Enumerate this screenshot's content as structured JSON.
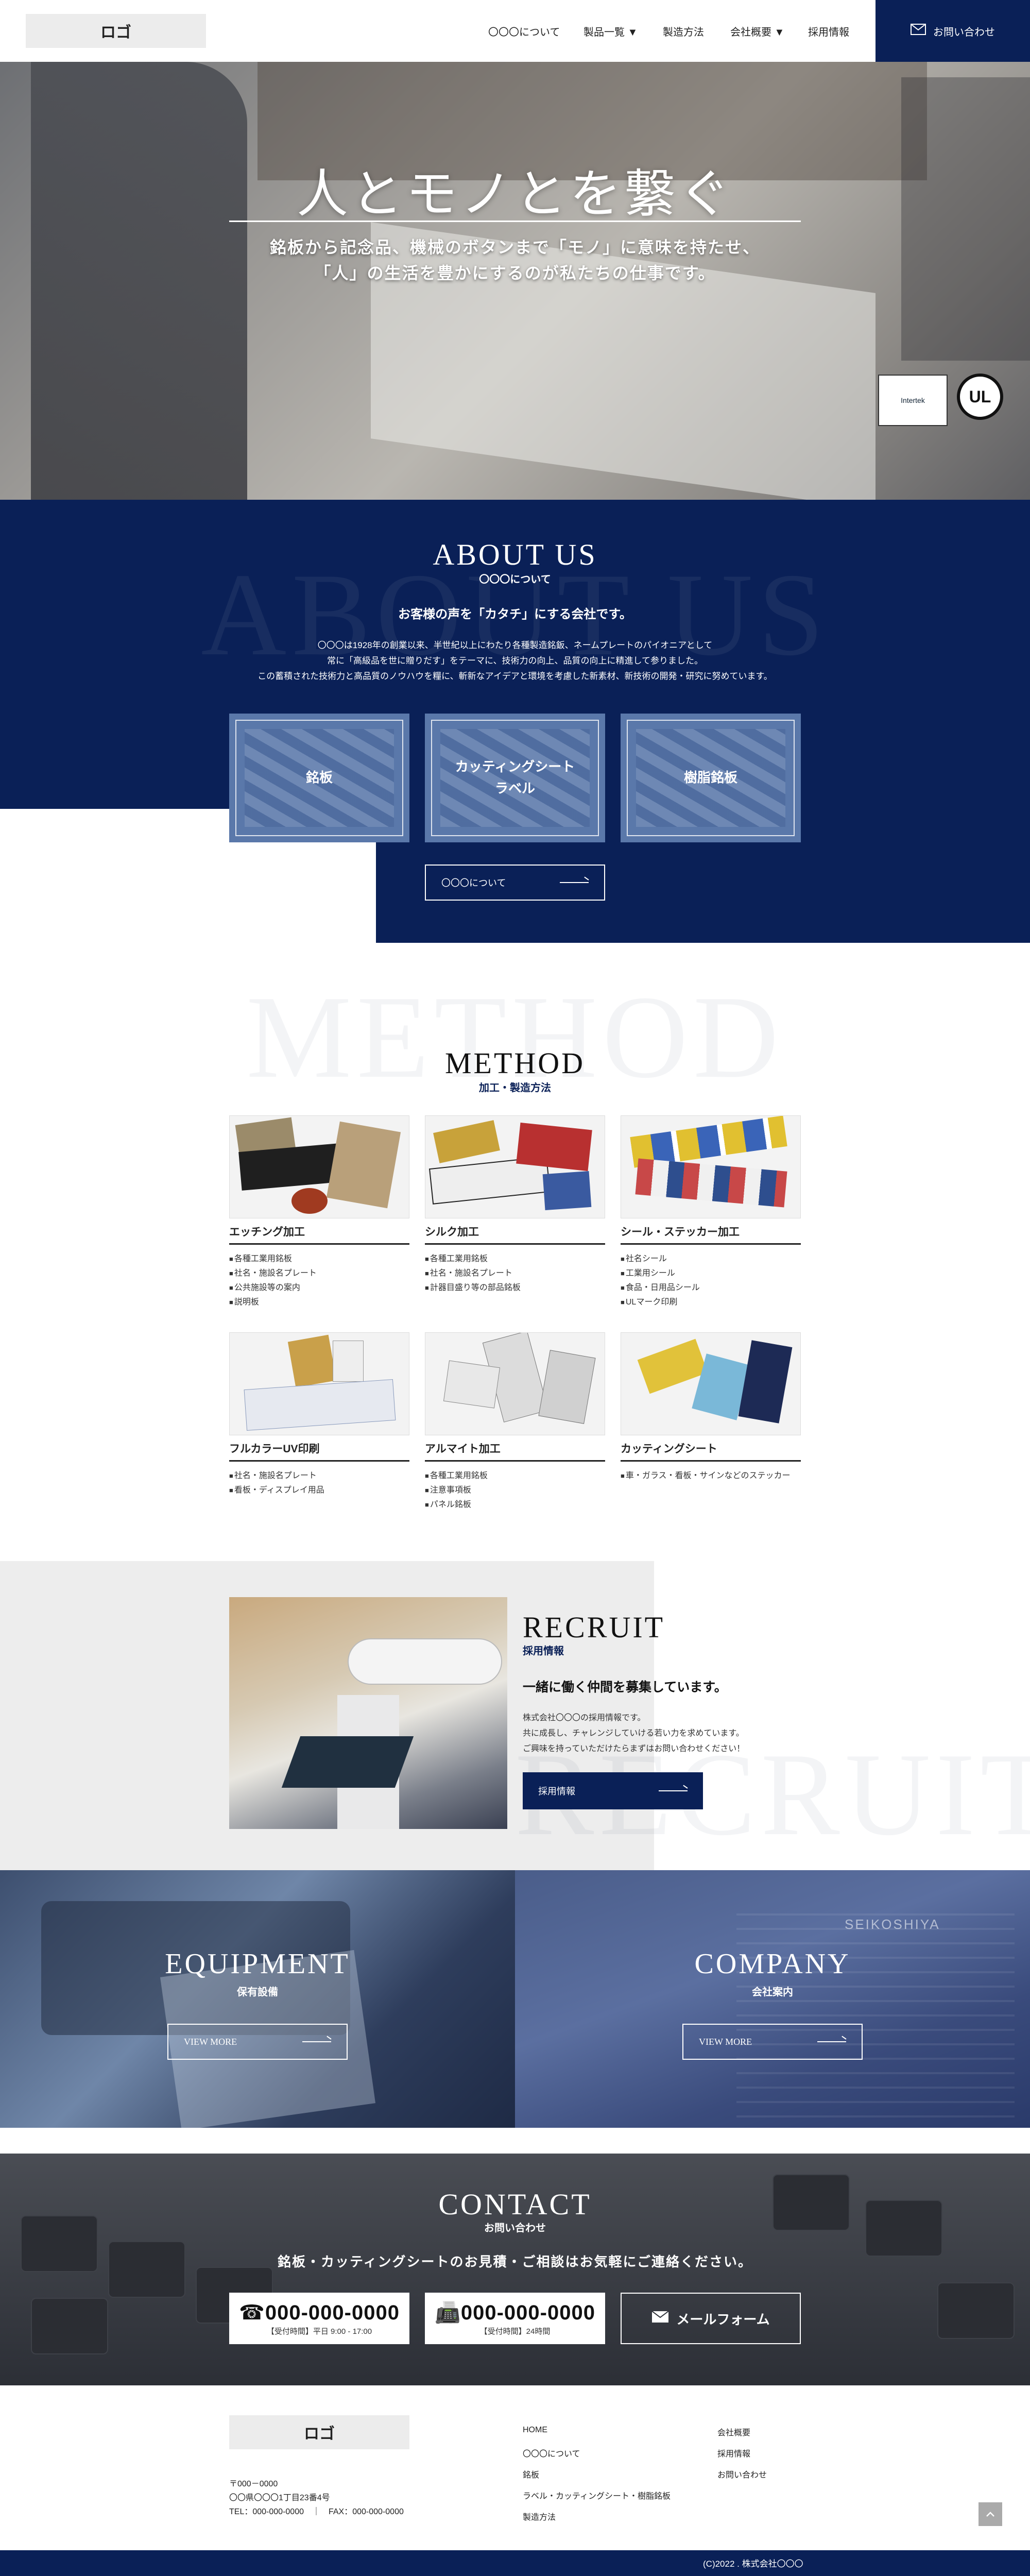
{
  "header": {
    "logo": "ロゴ",
    "nav": [
      "〇〇〇について",
      "製品一覧 ▼",
      "製造方法",
      "会社概要 ▼",
      "採用情報"
    ],
    "contact_label": "お問い合わせ"
  },
  "hero": {
    "title": "人とモノとを繋ぐ",
    "sub1": "銘板から記念品、機械のボタンまで「モノ」に意味を持たせ、",
    "sub2": "「人」の生活を豊かにするのが私たちの仕事です。",
    "cert1": "Intertek",
    "cert2": "UL"
  },
  "about": {
    "watermark": "ABOUT US",
    "title": "ABOUT US",
    "subtitle": "〇〇〇について",
    "lead": "お客様の声を「カタチ」にする会社です。",
    "text1": "〇〇〇は1928年の創業以来、半世紀以上にわたり各種製造銘鈑、ネームプレートのパイオニアとして",
    "text2": "常に「高級品を世に贈りだす」をテーマに、技術力の向上、品質の向上に精進して参りました。",
    "text3": "この蓄積された技術力と高品質のノウハウを糧に、斬新なアイデアと環境を考慮した新素材、新技術の開発・研究に努めています。",
    "cards": [
      {
        "label": "銘板"
      },
      {
        "label": "カッティングシート\nラベル"
      },
      {
        "label": "樹脂銘板"
      }
    ],
    "button": "〇〇〇について"
  },
  "method": {
    "watermark": "METHOD",
    "title": "METHOD",
    "subtitle": "加工・製造方法",
    "items": [
      {
        "title": "エッチング加工",
        "list": [
          "各種工業用銘板",
          "社名・施設名プレート",
          "公共施設等の案内",
          "説明板"
        ]
      },
      {
        "title": "シルク加工",
        "list": [
          "各種工業用銘板",
          "社名・施設名プレート",
          "計器目盛り等の部品銘板"
        ]
      },
      {
        "title": "シール・ステッカー加工",
        "list": [
          "社名シール",
          "工業用シール",
          "食品・日用品シール",
          "ULマーク印刷"
        ]
      },
      {
        "title": "フルカラーUV印刷",
        "list": [
          "社名・施設名プレート",
          "看板・ディスプレイ用品"
        ]
      },
      {
        "title": "アルマイト加工",
        "list": [
          "各種工業用銘板",
          "注意事項板",
          "パネル銘板"
        ]
      },
      {
        "title": "カッティングシート",
        "list": [
          "車・ガラス・看板・サインなどのステッカー"
        ]
      }
    ]
  },
  "recruit": {
    "watermark": "RECRUIT",
    "title": "RECRUIT",
    "subtitle": "採用情報",
    "lead": "一緒に働く仲間を募集しています。",
    "text1": "株式会社〇〇〇の採用情報です。",
    "text2": "共に成長し、チャレンジしていける若い力を求めています。",
    "text3": "ご興味を持っていただけたらまずはお問い合わせください！",
    "button": "採用情報"
  },
  "equipment": {
    "title": "EQUIPMENT",
    "subtitle": "保有設備",
    "button": "VIEW MORE"
  },
  "company": {
    "title": "COMPANY",
    "subtitle": "会社案内",
    "button": "VIEW MORE",
    "sign": "SEIKOSHIYA"
  },
  "contact": {
    "title": "CONTACT",
    "subtitle": "お問い合わせ",
    "lead": "銘板・カッティングシートのお見積・ご相談はお気軽にご連絡ください。",
    "tel": {
      "number": "☎000-000-0000",
      "note": "【受付時間】平日 9:00 - 17:00"
    },
    "fax": {
      "number": "📠000-000-0000",
      "note": "【受付時間】24時間"
    },
    "mail": "メールフォーム"
  },
  "footer": {
    "logo": "ロゴ",
    "address1": "〒000－0000",
    "address2": "〇〇県〇〇〇1丁目23番4号",
    "telfax": "TEL：000-000-0000　｜　FAX：000-000-0000",
    "links1": [
      "HOME",
      "〇〇〇について",
      "銘板",
      "ラベル・カッティングシート・樹脂銘板",
      "製造方法"
    ],
    "links2": [
      "会社概要",
      "採用情報",
      "お問い合わせ"
    ],
    "copyright": "(C)2022 . 株式会社〇〇〇"
  },
  "colors": {
    "navy": "#0a2057",
    "card": "#5a78aa",
    "light_gray": "#ededed"
  }
}
